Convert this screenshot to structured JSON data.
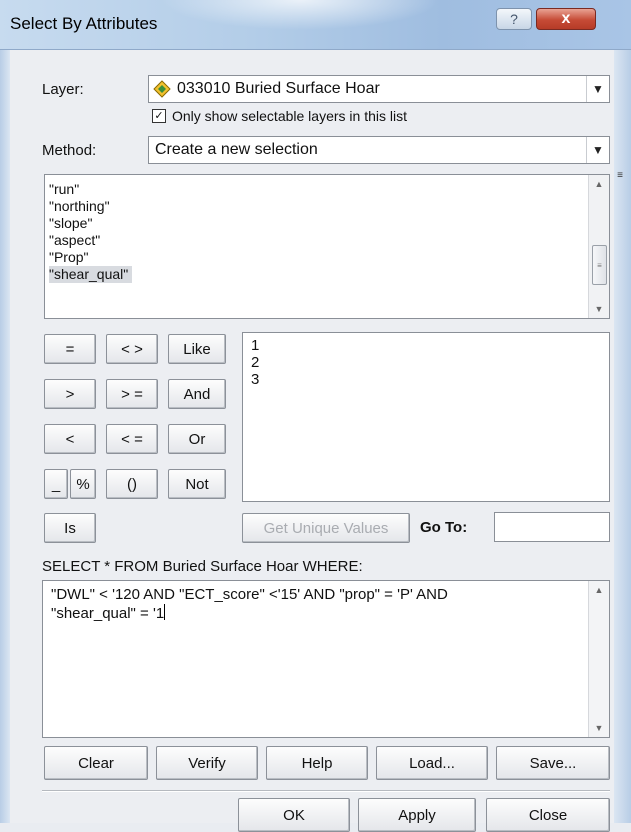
{
  "window": {
    "title": "Select By Attributes",
    "help_glyph": "?",
    "close_glyph": "x"
  },
  "layer": {
    "label": "Layer:",
    "value": "033010 Buried Surface Hoar",
    "icon": "layer-diamond-icon",
    "only_selectable_label": "Only show selectable layers in this list",
    "only_selectable_checked": true
  },
  "method": {
    "label": "Method:",
    "value": "Create a new selection"
  },
  "fields": [
    "\"run\"",
    "\"northing\"",
    "\"slope\"",
    "\"aspect\"",
    "\"Prop\"",
    "\"shear_qual\""
  ],
  "selected_field_index": 5,
  "operators": {
    "eq": "=",
    "ne": "< >",
    "like": "Like",
    "gt": ">",
    "ge": "> =",
    "and": "And",
    "lt": "<",
    "le": "< =",
    "or": "Or",
    "underscore": "_",
    "percent": "%",
    "parens": "()",
    "not": "Not",
    "is": "Is"
  },
  "unique_values": [
    "1",
    "2",
    "3"
  ],
  "get_unique_values_label": "Get Unique Values",
  "goto_label": "Go To:",
  "goto_value": "",
  "sql_header": "SELECT * FROM Buried Surface Hoar WHERE:",
  "sql_expression_line1": "\"DWL\" < '120 AND \"ECT_score\" <'15' AND \"prop\" = 'P' AND",
  "sql_expression_line2": "\"shear_qual\" = '1",
  "buttons": {
    "clear": "Clear",
    "verify": "Verify",
    "help": "Help",
    "load": "Load...",
    "save": "Save...",
    "ok": "OK",
    "apply": "Apply",
    "close": "Close"
  },
  "colors": {
    "titlebar": "#b3cde8",
    "close_button": "#c64b36",
    "dialog_bg": "#eceef2"
  }
}
